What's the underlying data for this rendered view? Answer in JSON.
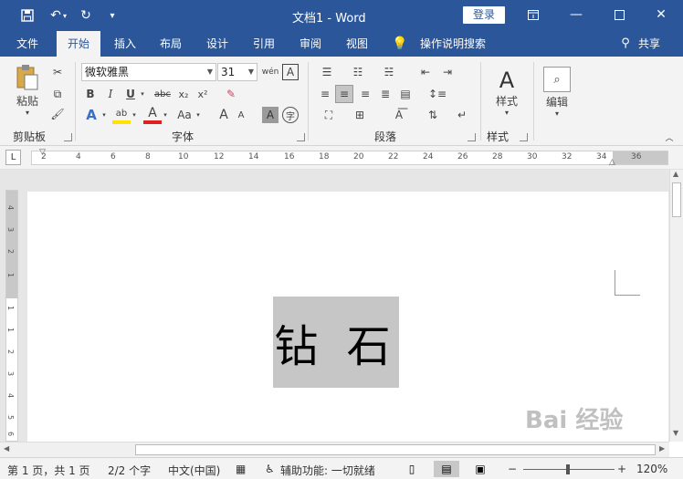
{
  "titlebar": {
    "title": "文档1  -  Word",
    "login": "登录",
    "icons": [
      "save-icon",
      "undo-icon",
      "redo-icon",
      "customize-qat-icon",
      "ribbon-display-icon",
      "minimize-icon",
      "maximize-icon",
      "close-icon"
    ]
  },
  "tabs": [
    "文件",
    "开始",
    "插入",
    "布局",
    "设计",
    "引用",
    "审阅",
    "视图"
  ],
  "tell_me": "操作说明搜索",
  "share": "共享",
  "ribbon": {
    "clipboard": {
      "paste": "粘贴",
      "label": "剪贴板"
    },
    "font": {
      "name": "微软雅黑",
      "size": "31",
      "label": "字体",
      "bold": "B",
      "italic": "I",
      "underline": "U",
      "strike": "abc",
      "subscript": "x₂",
      "superscript": "x²",
      "wen": "wén",
      "aa": "Aa",
      "a_big": "A",
      "a_small": "A",
      "char_border": "A",
      "enclose": "字"
    },
    "paragraph": {
      "label": "段落"
    },
    "styles": {
      "label": "样式",
      "button": "样式"
    },
    "editing": {
      "button": "编辑"
    }
  },
  "ruler": {
    "h_ticks": [
      "2",
      "4",
      "6",
      "8",
      "10",
      "12",
      "14",
      "16",
      "18",
      "20",
      "22",
      "24",
      "26",
      "28",
      "30",
      "32",
      "34",
      "36"
    ],
    "v_ticks": [
      "4",
      "3",
      "2",
      "1",
      "1",
      "1",
      "2",
      "3",
      "4",
      "5",
      "6"
    ],
    "tab_selector": "L"
  },
  "document": {
    "text": "钻 石"
  },
  "status": {
    "page": "第 1 页，共 1 页",
    "words": "2/2 个字",
    "lang": "中文(中国)",
    "accessibility": "辅助功能: 一切就绪",
    "zoom": "120%"
  },
  "watermark": "Bai 经验"
}
